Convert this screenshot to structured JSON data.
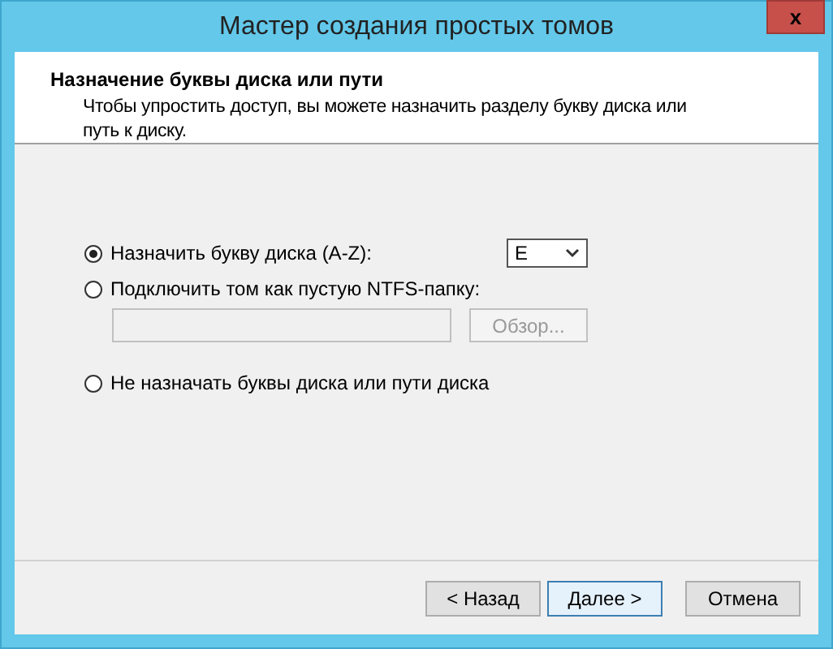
{
  "window": {
    "title": "Мастер создания простых томов",
    "close": "x"
  },
  "header": {
    "title": "Назначение буквы диска или пути",
    "description": "Чтобы упростить доступ, вы можете назначить разделу букву диска или путь к диску."
  },
  "options": [
    {
      "label": "Назначить букву диска (A-Z):",
      "selected": true,
      "kind": "letter",
      "value": "E"
    },
    {
      "label": "Подключить том как пустую NTFS-папку:",
      "selected": false,
      "kind": "folder",
      "button": "Обзор..."
    },
    {
      "label": "Не назначать буквы диска или пути диска",
      "selected": false,
      "kind": "plain"
    }
  ],
  "buttons": [
    {
      "label": "< Назад",
      "default": false
    },
    {
      "label": "Далее >",
      "default": true
    },
    {
      "label": "Отмена",
      "default": false
    }
  ]
}
